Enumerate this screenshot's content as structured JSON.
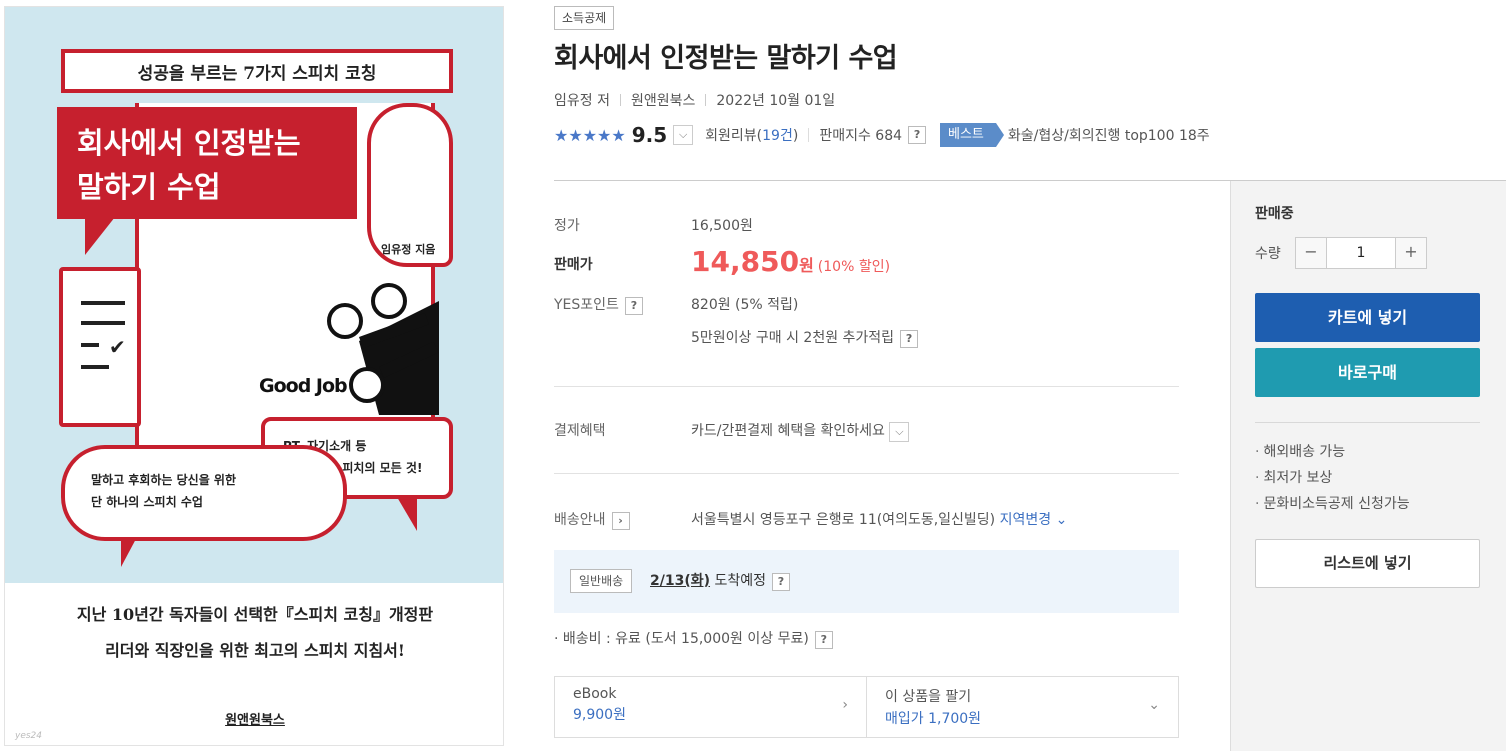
{
  "cover": {
    "banner": "성공을 부르는 7가지 스피치 코칭",
    "title_line1": "회사에서 인정받는",
    "title_line2": "말하기 수업",
    "author": "임유정 지음",
    "goodjob": "Good Job",
    "bubble_pt_line1": "PT, 자기소개 등",
    "bubble_pt_line2": "성공하는 스피치의 모든 것!",
    "bubble_main_line1": "말하고 후회하는 당신을 위한",
    "bubble_main_line2": "단 하나의 스피치 수업",
    "tagline1": "지난 10년간 독자들이 선택한『스피치 코칭』개정판",
    "tagline2": "리더와 직장인을 위한 최고의 스피치 지침서!",
    "publisher": "원앤원북스",
    "watermark": "yes24"
  },
  "product": {
    "badge": "소득공제",
    "title": "회사에서 인정받는 말하기 수업",
    "author": "임유정 저",
    "publisher": "원앤원북스",
    "date": "2022년 10월 01일",
    "stars": "★★★★★",
    "score": "9.5",
    "review_prefix": "회원리뷰(",
    "review_count": "19건",
    "review_suffix": ")",
    "sales_index_label": "판매지수 684",
    "best_label": "베스트",
    "best_rank": "화술/협상/회의진행 top100 18주"
  },
  "info": {
    "list_price_label": "정가",
    "list_price": "16,500원",
    "sale_price_label": "판매가",
    "sale_price": "14,850",
    "sale_unit": "원",
    "discount": "(10% 할인)",
    "points_label": "YES포인트",
    "points": "820원 (5% 적립)",
    "points_extra": "5만원이상 구매 시 2천원 추가적립",
    "payment_label": "결제혜택",
    "payment": "카드/간편결제 혜택을 확인하세요",
    "delivery_label": "배송안내",
    "delivery_address": "서울특별시 영등포구 은행로 11(여의도동,일신빌딩)",
    "delivery_change": "지역변경",
    "delivery_type": "일반배송",
    "delivery_date": "2/13(화)",
    "delivery_arrival": "도착예정",
    "shipping_fee": "· 배송비 : 유료 (도서 15,000원 이상 무료)",
    "ebook_label": "eBook",
    "ebook_price": "9,900원",
    "sell_label": "이 상품을 팔기",
    "sell_price": "매입가 1,700원"
  },
  "panel": {
    "status": "판매중",
    "qty_label": "수량",
    "qty_value": "1",
    "cart_button": "카트에 넣기",
    "buy_button": "바로구매",
    "features": [
      "해외배송 가능",
      "최저가 보상",
      "문화비소득공제 신청가능"
    ],
    "list_button": "리스트에 넣기"
  },
  "colors": {
    "sale": "#ef5a5a",
    "link": "#3b6fc1",
    "cart": "#1e5eb0",
    "buy": "#1f9bb0",
    "best": "#5b8cc9",
    "cover_red": "#c6202e",
    "cover_bg": "#cfe7ef"
  }
}
